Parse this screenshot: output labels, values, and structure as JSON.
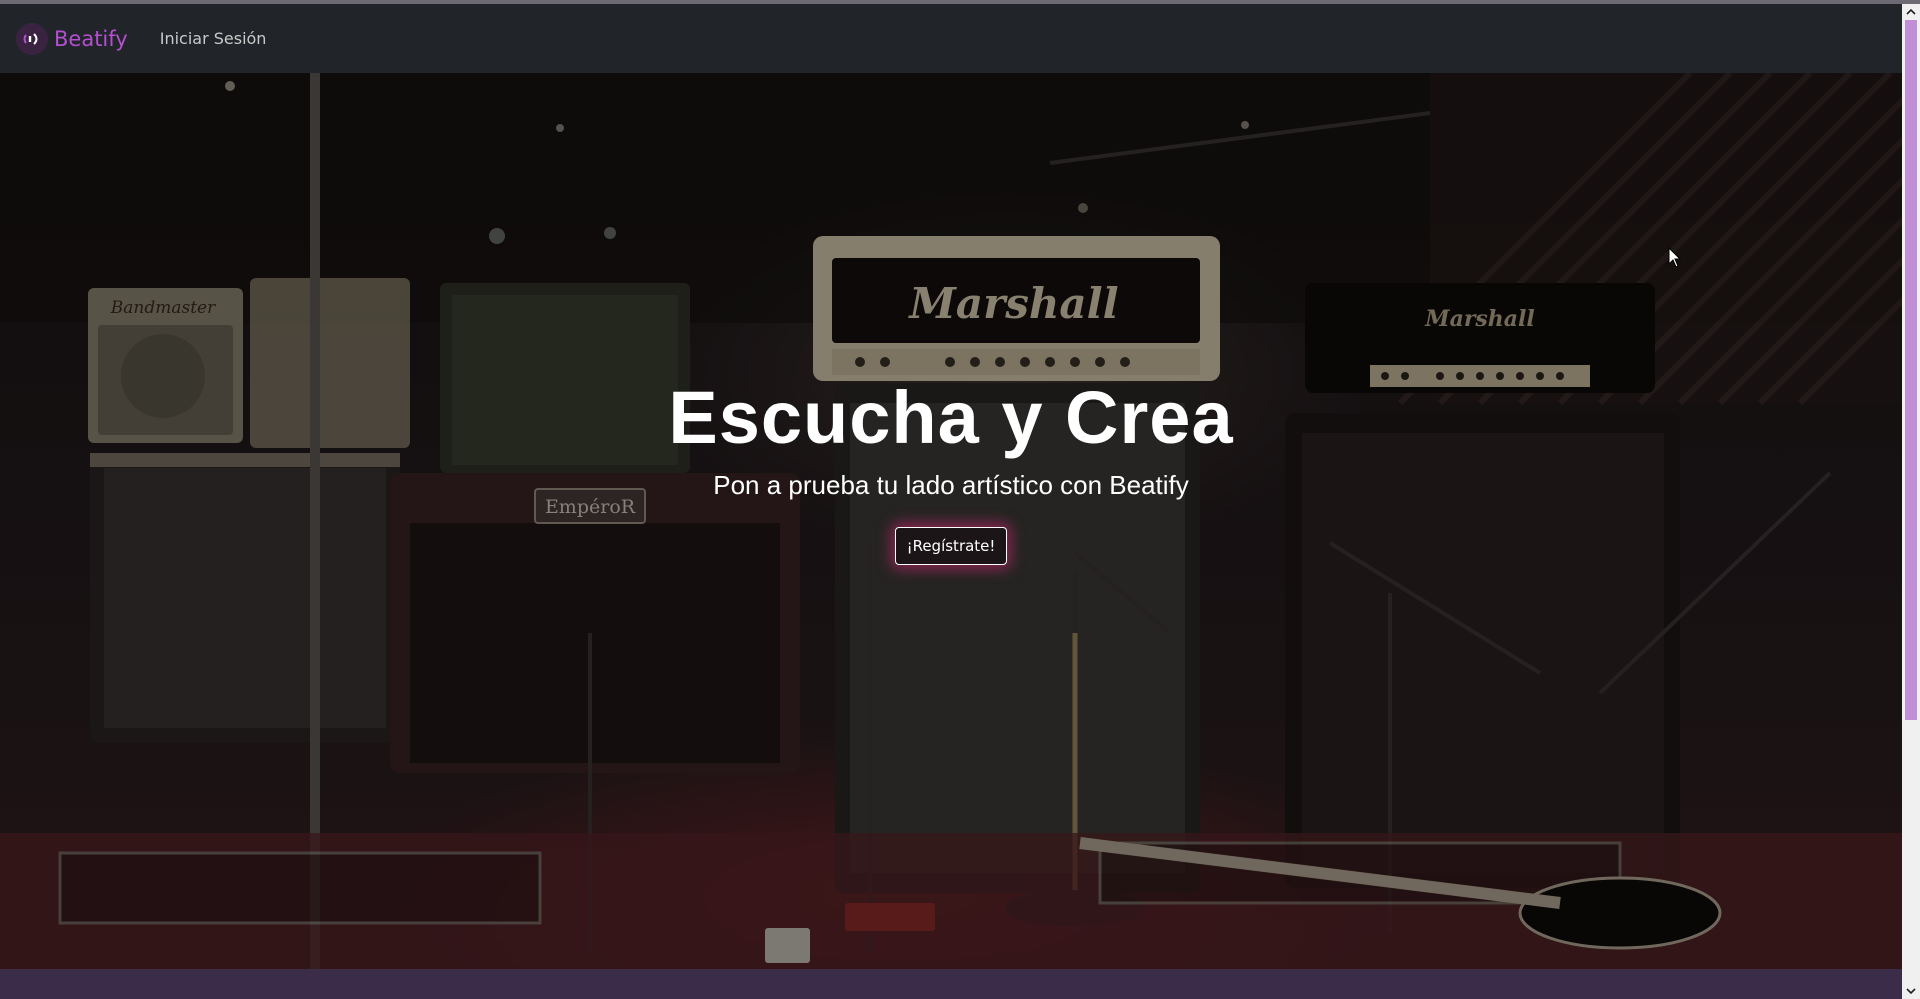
{
  "navbar": {
    "brand": "Beatify",
    "login_link": "Iniciar Sesión"
  },
  "hero": {
    "title": "Escucha y Crea",
    "subtitle": "Pon a prueba tu lado artístico con Beatify",
    "cta_label": "¡Regístrate!",
    "amp_brands": [
      "Marshall",
      "Marshall",
      "EmpéroR",
      "Bandmaster"
    ]
  },
  "colors": {
    "brand_accent": "#b44fd0",
    "navbar_bg": "#212529",
    "scroll_thumb": "#c28ed6",
    "footer_strip": "#3b2c4a",
    "cta_glow": "#dc2878"
  },
  "icons": {
    "logo": "sound-wave-icon",
    "scroll_up": "chevron-up-icon",
    "scroll_down": "chevron-down-icon",
    "cursor": "mouse-pointer-icon"
  }
}
